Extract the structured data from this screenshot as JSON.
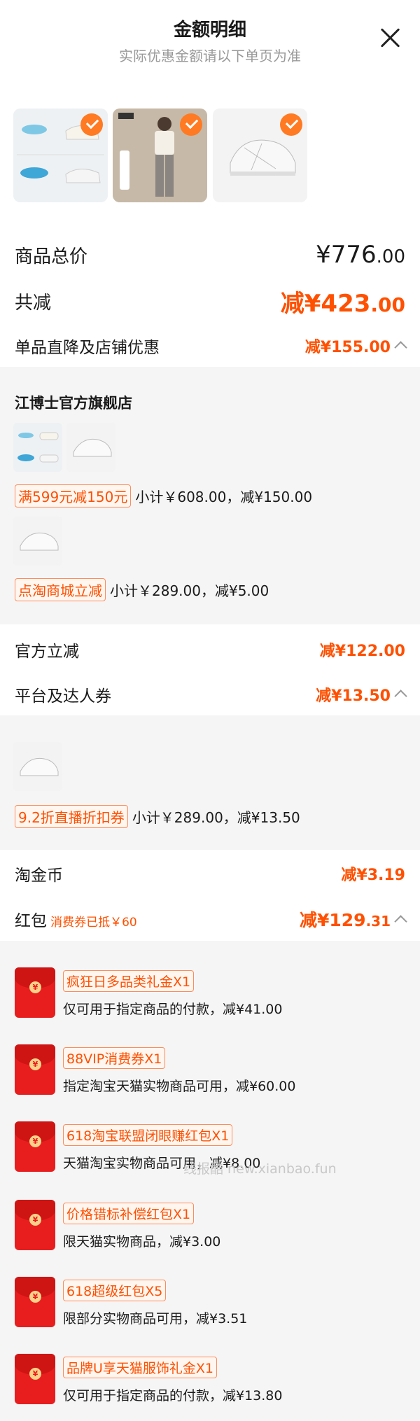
{
  "header": {
    "title": "金额明细",
    "subtitle": "实际优惠金额请以下单页为准"
  },
  "totals": {
    "price_label": "商品总价",
    "price_value": "¥776",
    "price_decimals": ".00",
    "discount_label": "共减",
    "discount_value": "减¥423",
    "discount_decimals": ".00"
  },
  "store_discount": {
    "label": "单品直降及店铺优惠",
    "value": "减¥155.00"
  },
  "store": {
    "name": "江博士官方旗舰店",
    "promo1": {
      "tag": "满599元减150元",
      "text": "小计￥608.00，减¥150.00"
    },
    "promo2": {
      "tag": "点淘商城立减",
      "text": "小计￥289.00，减¥5.00"
    }
  },
  "official": {
    "label": "官方立减",
    "value": "减¥122.00"
  },
  "platform": {
    "label": "平台及达人券",
    "value": "减¥13.50",
    "promo": {
      "tag": "9.2折直播折扣券",
      "text": "小计￥289.00，减¥13.50"
    }
  },
  "coins": {
    "label": "淘金币",
    "value": "减¥3.19"
  },
  "redpacket": {
    "label": "红包",
    "note": "消费券已抵￥60",
    "value": "减¥129",
    "decimals": ".31"
  },
  "packets": [
    {
      "name": "疯狂日多品类礼金X1",
      "desc": "仅可用于指定商品的付款，减¥41.00"
    },
    {
      "name": "88VIP消费券X1",
      "desc": "指定淘宝天猫实物商品可用，减¥60.00"
    },
    {
      "name": "618淘宝联盟闭眼赚红包X1",
      "desc": "天猫淘宝实物商品可用，减¥8.00"
    },
    {
      "name": "价格错标补偿红包X1",
      "desc": "限天猫实物商品，减¥3.00"
    },
    {
      "name": "618超级红包X5",
      "desc": "限部分实物商品可用，减¥3.51"
    },
    {
      "name": "品牌U享天猫服饰礼金X1",
      "desc": "仅可用于指定商品的付款，减¥13.80"
    }
  ],
  "watermark": "线报酷 new.xianbao.fun",
  "icons": {
    "close": "close-icon",
    "check": "check-icon",
    "chevron": "chevron-up-icon",
    "redpacket": "red-envelope-icon"
  },
  "colors": {
    "accent": "#ff5000",
    "check": "#ff7a22",
    "redpacket": "#e81e1e"
  }
}
